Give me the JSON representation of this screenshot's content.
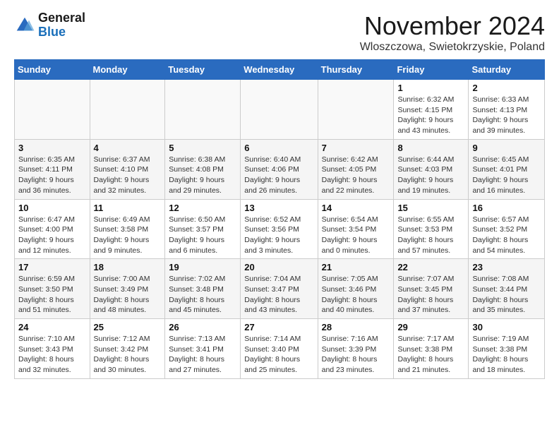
{
  "logo": {
    "line1": "General",
    "line2": "Blue"
  },
  "header": {
    "month": "November 2024",
    "location": "Wloszczowa, Swietokrzyskie, Poland"
  },
  "days_of_week": [
    "Sunday",
    "Monday",
    "Tuesday",
    "Wednesday",
    "Thursday",
    "Friday",
    "Saturday"
  ],
  "weeks": [
    [
      {
        "day": "",
        "info": ""
      },
      {
        "day": "",
        "info": ""
      },
      {
        "day": "",
        "info": ""
      },
      {
        "day": "",
        "info": ""
      },
      {
        "day": "",
        "info": ""
      },
      {
        "day": "1",
        "info": "Sunrise: 6:32 AM\nSunset: 4:15 PM\nDaylight: 9 hours\nand 43 minutes."
      },
      {
        "day": "2",
        "info": "Sunrise: 6:33 AM\nSunset: 4:13 PM\nDaylight: 9 hours\nand 39 minutes."
      }
    ],
    [
      {
        "day": "3",
        "info": "Sunrise: 6:35 AM\nSunset: 4:11 PM\nDaylight: 9 hours\nand 36 minutes."
      },
      {
        "day": "4",
        "info": "Sunrise: 6:37 AM\nSunset: 4:10 PM\nDaylight: 9 hours\nand 32 minutes."
      },
      {
        "day": "5",
        "info": "Sunrise: 6:38 AM\nSunset: 4:08 PM\nDaylight: 9 hours\nand 29 minutes."
      },
      {
        "day": "6",
        "info": "Sunrise: 6:40 AM\nSunset: 4:06 PM\nDaylight: 9 hours\nand 26 minutes."
      },
      {
        "day": "7",
        "info": "Sunrise: 6:42 AM\nSunset: 4:05 PM\nDaylight: 9 hours\nand 22 minutes."
      },
      {
        "day": "8",
        "info": "Sunrise: 6:44 AM\nSunset: 4:03 PM\nDaylight: 9 hours\nand 19 minutes."
      },
      {
        "day": "9",
        "info": "Sunrise: 6:45 AM\nSunset: 4:01 PM\nDaylight: 9 hours\nand 16 minutes."
      }
    ],
    [
      {
        "day": "10",
        "info": "Sunrise: 6:47 AM\nSunset: 4:00 PM\nDaylight: 9 hours\nand 12 minutes."
      },
      {
        "day": "11",
        "info": "Sunrise: 6:49 AM\nSunset: 3:58 PM\nDaylight: 9 hours\nand 9 minutes."
      },
      {
        "day": "12",
        "info": "Sunrise: 6:50 AM\nSunset: 3:57 PM\nDaylight: 9 hours\nand 6 minutes."
      },
      {
        "day": "13",
        "info": "Sunrise: 6:52 AM\nSunset: 3:56 PM\nDaylight: 9 hours\nand 3 minutes."
      },
      {
        "day": "14",
        "info": "Sunrise: 6:54 AM\nSunset: 3:54 PM\nDaylight: 9 hours\nand 0 minutes."
      },
      {
        "day": "15",
        "info": "Sunrise: 6:55 AM\nSunset: 3:53 PM\nDaylight: 8 hours\nand 57 minutes."
      },
      {
        "day": "16",
        "info": "Sunrise: 6:57 AM\nSunset: 3:52 PM\nDaylight: 8 hours\nand 54 minutes."
      }
    ],
    [
      {
        "day": "17",
        "info": "Sunrise: 6:59 AM\nSunset: 3:50 PM\nDaylight: 8 hours\nand 51 minutes."
      },
      {
        "day": "18",
        "info": "Sunrise: 7:00 AM\nSunset: 3:49 PM\nDaylight: 8 hours\nand 48 minutes."
      },
      {
        "day": "19",
        "info": "Sunrise: 7:02 AM\nSunset: 3:48 PM\nDaylight: 8 hours\nand 45 minutes."
      },
      {
        "day": "20",
        "info": "Sunrise: 7:04 AM\nSunset: 3:47 PM\nDaylight: 8 hours\nand 43 minutes."
      },
      {
        "day": "21",
        "info": "Sunrise: 7:05 AM\nSunset: 3:46 PM\nDaylight: 8 hours\nand 40 minutes."
      },
      {
        "day": "22",
        "info": "Sunrise: 7:07 AM\nSunset: 3:45 PM\nDaylight: 8 hours\nand 37 minutes."
      },
      {
        "day": "23",
        "info": "Sunrise: 7:08 AM\nSunset: 3:44 PM\nDaylight: 8 hours\nand 35 minutes."
      }
    ],
    [
      {
        "day": "24",
        "info": "Sunrise: 7:10 AM\nSunset: 3:43 PM\nDaylight: 8 hours\nand 32 minutes."
      },
      {
        "day": "25",
        "info": "Sunrise: 7:12 AM\nSunset: 3:42 PM\nDaylight: 8 hours\nand 30 minutes."
      },
      {
        "day": "26",
        "info": "Sunrise: 7:13 AM\nSunset: 3:41 PM\nDaylight: 8 hours\nand 27 minutes."
      },
      {
        "day": "27",
        "info": "Sunrise: 7:14 AM\nSunset: 3:40 PM\nDaylight: 8 hours\nand 25 minutes."
      },
      {
        "day": "28",
        "info": "Sunrise: 7:16 AM\nSunset: 3:39 PM\nDaylight: 8 hours\nand 23 minutes."
      },
      {
        "day": "29",
        "info": "Sunrise: 7:17 AM\nSunset: 3:38 PM\nDaylight: 8 hours\nand 21 minutes."
      },
      {
        "day": "30",
        "info": "Sunrise: 7:19 AM\nSunset: 3:38 PM\nDaylight: 8 hours\nand 18 minutes."
      }
    ]
  ]
}
